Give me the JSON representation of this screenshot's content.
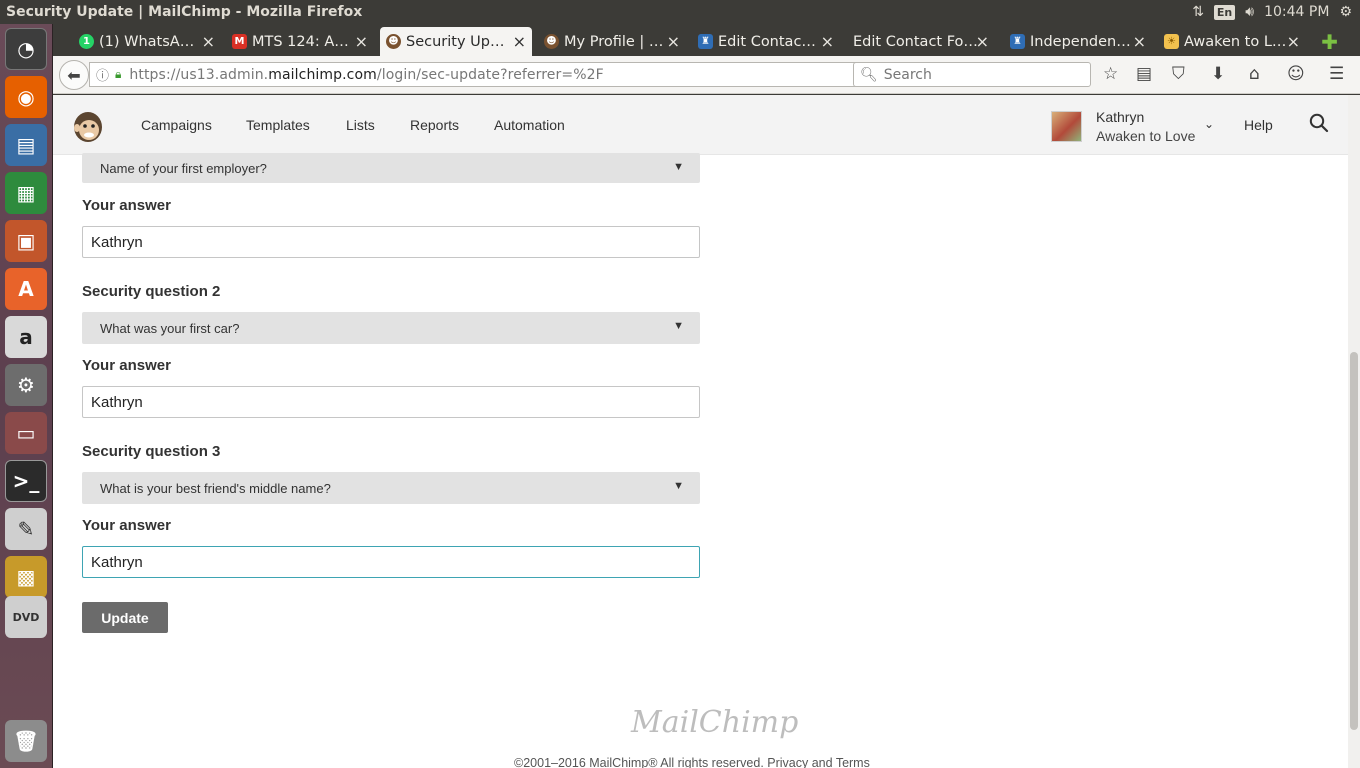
{
  "system": {
    "window_title": "Security Update | MailChimp - Mozilla Firefox",
    "lang": "En",
    "clock": "10:44 PM"
  },
  "tabs": [
    {
      "label": "(1) WhatsA…",
      "icon": "whatsapp-icon",
      "color": "#25d366",
      "glyph": "1"
    },
    {
      "label": "MTS 124: A…",
      "icon": "gmail-icon",
      "color": "#d93025",
      "glyph": "M"
    },
    {
      "label": "Security Up…",
      "icon": "mailchimp-icon",
      "color": "#7a5230",
      "glyph": "☻",
      "active": true
    },
    {
      "label": "My Profile | …",
      "icon": "mailchimp-icon",
      "color": "#7a5230",
      "glyph": "☻"
    },
    {
      "label": "Edit Contac…",
      "icon": "site-icon",
      "color": "#2f6db5",
      "glyph": "♜"
    },
    {
      "label": "Edit Contact Fo…",
      "icon": "blank-icon",
      "color": "transparent",
      "glyph": ""
    },
    {
      "label": "Independen…",
      "icon": "site-icon",
      "color": "#2f6db5",
      "glyph": "♜"
    },
    {
      "label": "Awaken to L…",
      "icon": "awaken-icon",
      "color": "#f2c14e",
      "glyph": "☀"
    }
  ],
  "navbar": {
    "url_prefix": "https://us13.admin.",
    "url_domain": "mailchimp.com",
    "url_suffix": "/login/sec-update?referrer=%2F",
    "search_placeholder": "Search"
  },
  "mc_nav": [
    "Campaigns",
    "Templates",
    "Lists",
    "Reports",
    "Automation"
  ],
  "account": {
    "name": "Kathryn",
    "org": "Awaken to Love",
    "help": "Help"
  },
  "form": {
    "q1_select": "Name of your first employer?",
    "answer_label": "Your answer",
    "a1": "Kathryn",
    "q2_label": "Security question 2",
    "q2_select": "What was your first car?",
    "a2": "Kathryn",
    "q3_label": "Security question 3",
    "q3_select": "What is your best friend's middle name?",
    "a3": "Kathryn",
    "update_label": "Update"
  },
  "footer": {
    "logo": "MailChimp",
    "copyright": "©2001–2016 MailChimp® All rights reserved. Privacy and Terms"
  },
  "colors": {
    "accent_focus": "#3ea4b3",
    "button_gray": "#6b6b6b",
    "launcher": "#5c3f4e"
  }
}
